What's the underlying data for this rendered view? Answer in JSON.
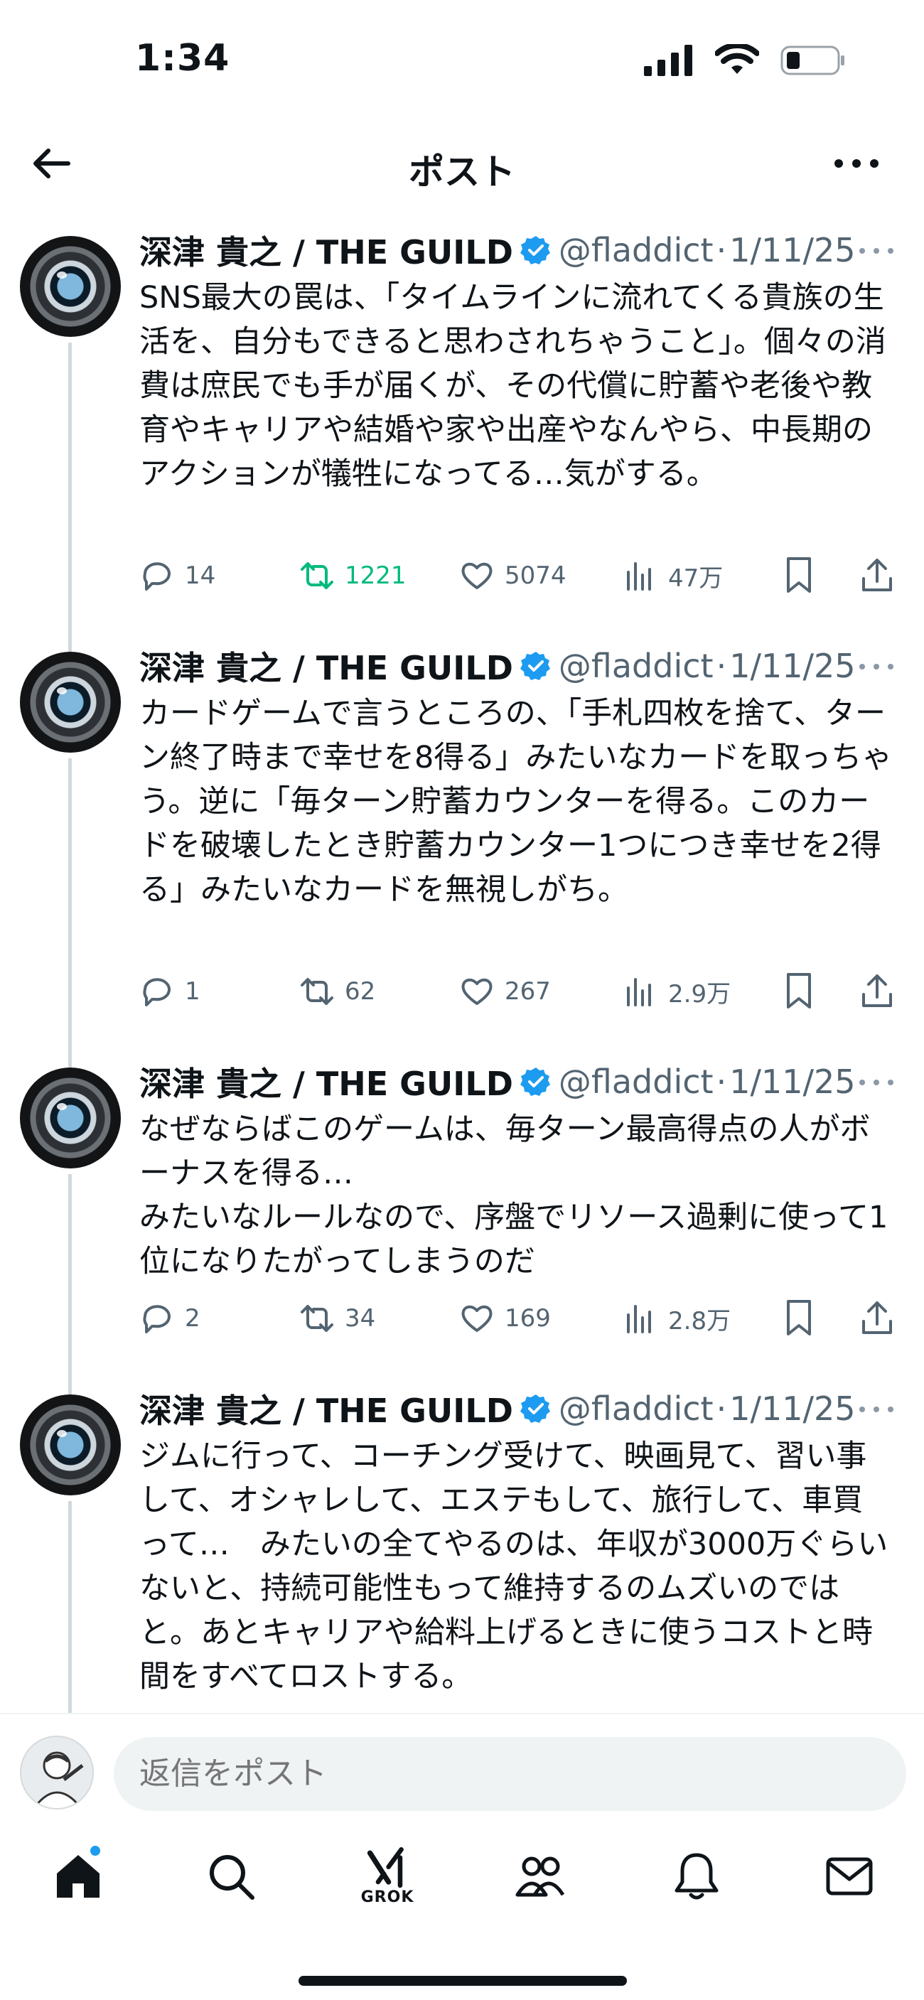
{
  "status_bar": {
    "time": "1:34"
  },
  "header": {
    "title": "ポスト"
  },
  "author": {
    "name": "深津 貴之 / THE GUILD",
    "handle": "@fladdict",
    "date": "1/11/25",
    "separator": "·"
  },
  "tweets": [
    {
      "text": "SNS最大の罠は、「タイムラインに流れてくる貴族の生活を、自分もできると思わされちゃうこと」。個々の消費は庶民でも手が届くが、その代償に貯蓄や老後や教育やキャリアや結婚や家や出産やなんやら、中長期のアクションが犠牲になってる…気がする。",
      "replies": "14",
      "reposts": "1221",
      "likes": "5074",
      "views": "47万"
    },
    {
      "text": "カードゲームで言うところの、「手札四枚を捨て、ターン終了時まで幸せを8得る」みたいなカードを取っちゃう。逆に「毎ターン貯蓄カウンターを得る。このカードを破壊したとき貯蓄カウンター1つにつき幸せを2得る」みたいなカードを無視しがち。",
      "replies": "1",
      "reposts": "62",
      "likes": "267",
      "views": "2.9万"
    },
    {
      "text": "なぜならばこのゲームは、毎ターン最高得点の人がボーナスを得る…\nみたいなルールなので、序盤でリソース過剰に使って1位になりたがってしまうのだ",
      "replies": "2",
      "reposts": "34",
      "likes": "169",
      "views": "2.8万"
    },
    {
      "text": "ジムに行って、コーチング受けて、映画見て、習い事して、オシャレして、エステもして、旅行して、車買って…　みたいの全てやるのは、年収が3000万ぐらいないと、持続可能性もって維持するのムズいのではと。あとキャリアや給料上げるときに使うコストと時間をすべてロストする。"
    }
  ],
  "reply": {
    "placeholder": "返信をポスト"
  },
  "nav": {
    "grok_label": "GROK"
  },
  "colors": {
    "accent": "#1d9bf0",
    "repost_active": "#00ba7c",
    "secondary_text": "#536471"
  }
}
